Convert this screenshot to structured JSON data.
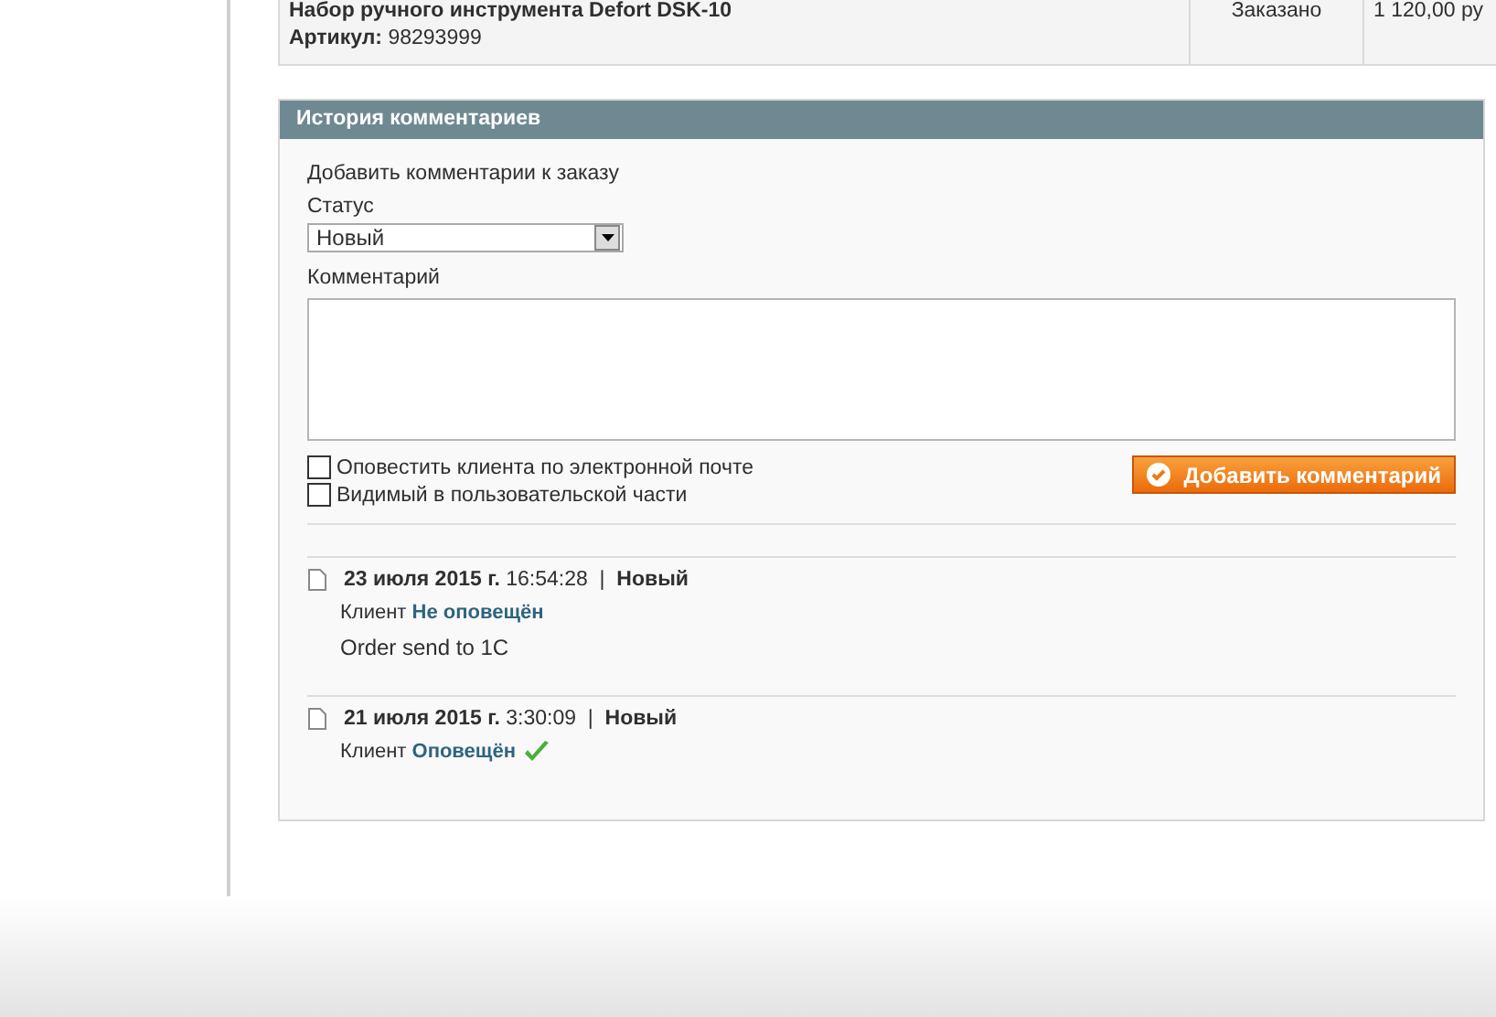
{
  "order_item": {
    "name": "Набор ручного инструмента Defort DSK-10",
    "sku_label": "Артикул:",
    "sku": "98293999",
    "status": "Заказано",
    "price": "1 120,00 ру"
  },
  "history": {
    "title": "История комментариев",
    "form_title": "Добавить комментарии к заказу",
    "status_label": "Статус",
    "status_value": "Новый",
    "comment_label": "Комментарий",
    "checkboxes": [
      {
        "label": "Оповестить клиента по электронной почте",
        "checked": false
      },
      {
        "label": "Видимый в пользовательской части",
        "checked": false
      }
    ],
    "submit": "Добавить комментарий",
    "entries": [
      {
        "date": "23 июля 2015 г.",
        "time": "16:54:28",
        "separator": "|",
        "status": "Новый",
        "customer_label": "Клиент",
        "notify_text": "Не оповещён",
        "notified": false,
        "comment": "Order send to 1C"
      },
      {
        "date": "21 июля 2015 г.",
        "time": "3:30:09",
        "separator": "|",
        "status": "Новый",
        "customer_label": "Клиент",
        "notify_text": "Оповещён",
        "notified": true
      }
    ]
  }
}
